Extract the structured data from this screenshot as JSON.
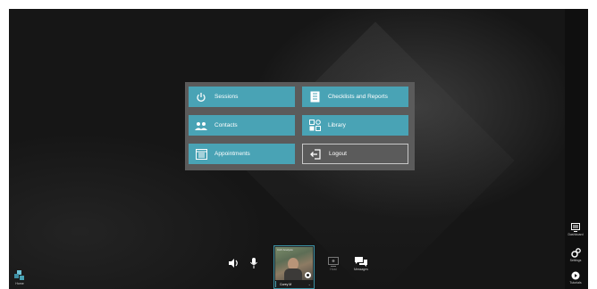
{
  "menu": {
    "items": [
      {
        "label": "Sessions",
        "icon": "power-icon"
      },
      {
        "label": "Checklists and Reports",
        "icon": "checklist-icon"
      },
      {
        "label": "Contacts",
        "icon": "contacts-icon"
      },
      {
        "label": "Library",
        "icon": "library-icon"
      },
      {
        "label": "Appointments",
        "icon": "calendar-icon"
      },
      {
        "label": "Logout",
        "icon": "logout-icon"
      }
    ]
  },
  "bottom_bar": {
    "home_label": "Home",
    "host_label": "Host",
    "messages_label": "Messages",
    "video": {
      "overlay_text": "CAV Analysis",
      "participant_name": "Corey M"
    }
  },
  "side_bar": {
    "dashboard_label": "Dashboard",
    "settings_label": "Settings",
    "tutorials_label": "Tutorials"
  },
  "colors": {
    "accent": "#49a3b5",
    "panel": "#5b5b5b",
    "background": "#161616"
  }
}
